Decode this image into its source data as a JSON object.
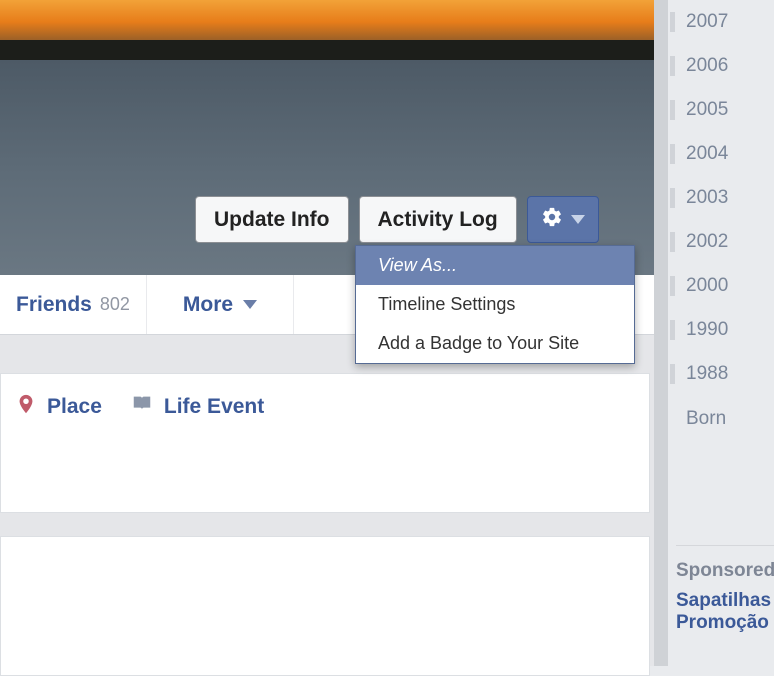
{
  "cover": {
    "buttons": {
      "update_info": "Update Info",
      "activity_log": "Activity Log"
    },
    "gear_icon": "gear-icon",
    "dropdown": {
      "items": [
        "View As...",
        "Timeline Settings",
        "Add a Badge to Your Site"
      ],
      "selected_index": 0
    }
  },
  "tabs": {
    "friends": {
      "label": "Friends",
      "count": "802"
    },
    "more": {
      "label": "More"
    }
  },
  "composer": {
    "place": {
      "label": "Place"
    },
    "life_event": {
      "label": "Life Event"
    }
  },
  "timeline_years": [
    "2007",
    "2006",
    "2005",
    "2004",
    "2003",
    "2002",
    "2000",
    "1990",
    "1988"
  ],
  "timeline_born": "Born",
  "sponsored": {
    "header": "Sponsored",
    "line1": "Sapatilhas",
    "line2": "Promoção"
  }
}
